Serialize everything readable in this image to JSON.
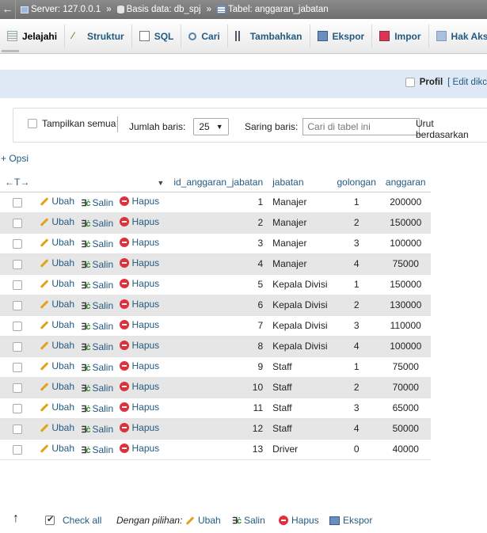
{
  "breadcrumb": {
    "server": "Server: 127.0.0.1",
    "database": "Basis data: db_spj",
    "table": "Tabel: anggaran_jabatan",
    "separator": "»"
  },
  "tabs": [
    {
      "label": "Jelajahi",
      "icon": "browse-icon"
    },
    {
      "label": "Struktur",
      "icon": "structure-icon"
    },
    {
      "label": "SQL",
      "icon": "sql-icon"
    },
    {
      "label": "Cari",
      "icon": "search-icon"
    },
    {
      "label": "Tambahkan",
      "icon": "insert-icon"
    },
    {
      "label": "Ekspor",
      "icon": "export-icon"
    },
    {
      "label": "Impor",
      "icon": "import-icon"
    },
    {
      "label": "Hak Aks",
      "icon": "privileges-icon"
    }
  ],
  "profile": {
    "label": "Profil",
    "edit": "[ Edit dikc"
  },
  "nav": {
    "show_all": "Tampilkan semua",
    "rows_label": "Jumlah baris:",
    "rows_value": "25",
    "filter_label": "Saring baris:",
    "filter_placeholder": "Cari di tabel ini",
    "sort_label": "Urut berdasarkan"
  },
  "options_link": "+ Opsi",
  "column_arrows": "←T→",
  "sort_arrow": "▼",
  "columns": [
    "id_anggaran_jabatan",
    "jabatan",
    "golongan",
    "anggaran"
  ],
  "actions": {
    "edit": "Ubah",
    "copy": "Salin",
    "delete": "Hapus"
  },
  "rows": [
    {
      "id": "1",
      "jabatan": "Manajer",
      "golongan": "1",
      "anggaran": "200000"
    },
    {
      "id": "2",
      "jabatan": "Manajer",
      "golongan": "2",
      "anggaran": "150000"
    },
    {
      "id": "3",
      "jabatan": "Manajer",
      "golongan": "3",
      "anggaran": "100000"
    },
    {
      "id": "4",
      "jabatan": "Manajer",
      "golongan": "4",
      "anggaran": "75000"
    },
    {
      "id": "5",
      "jabatan": "Kepala Divisi",
      "golongan": "1",
      "anggaran": "150000"
    },
    {
      "id": "6",
      "jabatan": "Kepala Divisi",
      "golongan": "2",
      "anggaran": "130000"
    },
    {
      "id": "7",
      "jabatan": "Kepala Divisi",
      "golongan": "3",
      "anggaran": "110000"
    },
    {
      "id": "8",
      "jabatan": "Kepala Divisi",
      "golongan": "4",
      "anggaran": "100000"
    },
    {
      "id": "9",
      "jabatan": "Staff",
      "golongan": "1",
      "anggaran": "75000"
    },
    {
      "id": "10",
      "jabatan": "Staff",
      "golongan": "2",
      "anggaran": "70000"
    },
    {
      "id": "11",
      "jabatan": "Staff",
      "golongan": "3",
      "anggaran": "65000"
    },
    {
      "id": "12",
      "jabatan": "Staff",
      "golongan": "4",
      "anggaran": "50000"
    },
    {
      "id": "13",
      "jabatan": "Driver",
      "golongan": "0",
      "anggaran": "40000"
    }
  ],
  "footer": {
    "check_all": "Check all",
    "with_selected": "Dengan pilihan:",
    "edit": "Ubah",
    "copy": "Salin",
    "delete": "Hapus",
    "export": "Ekspor"
  },
  "colors": {
    "link": "#235a81",
    "row_alt": "#e6e6e6",
    "profile_bar": "#dfe9f5"
  }
}
